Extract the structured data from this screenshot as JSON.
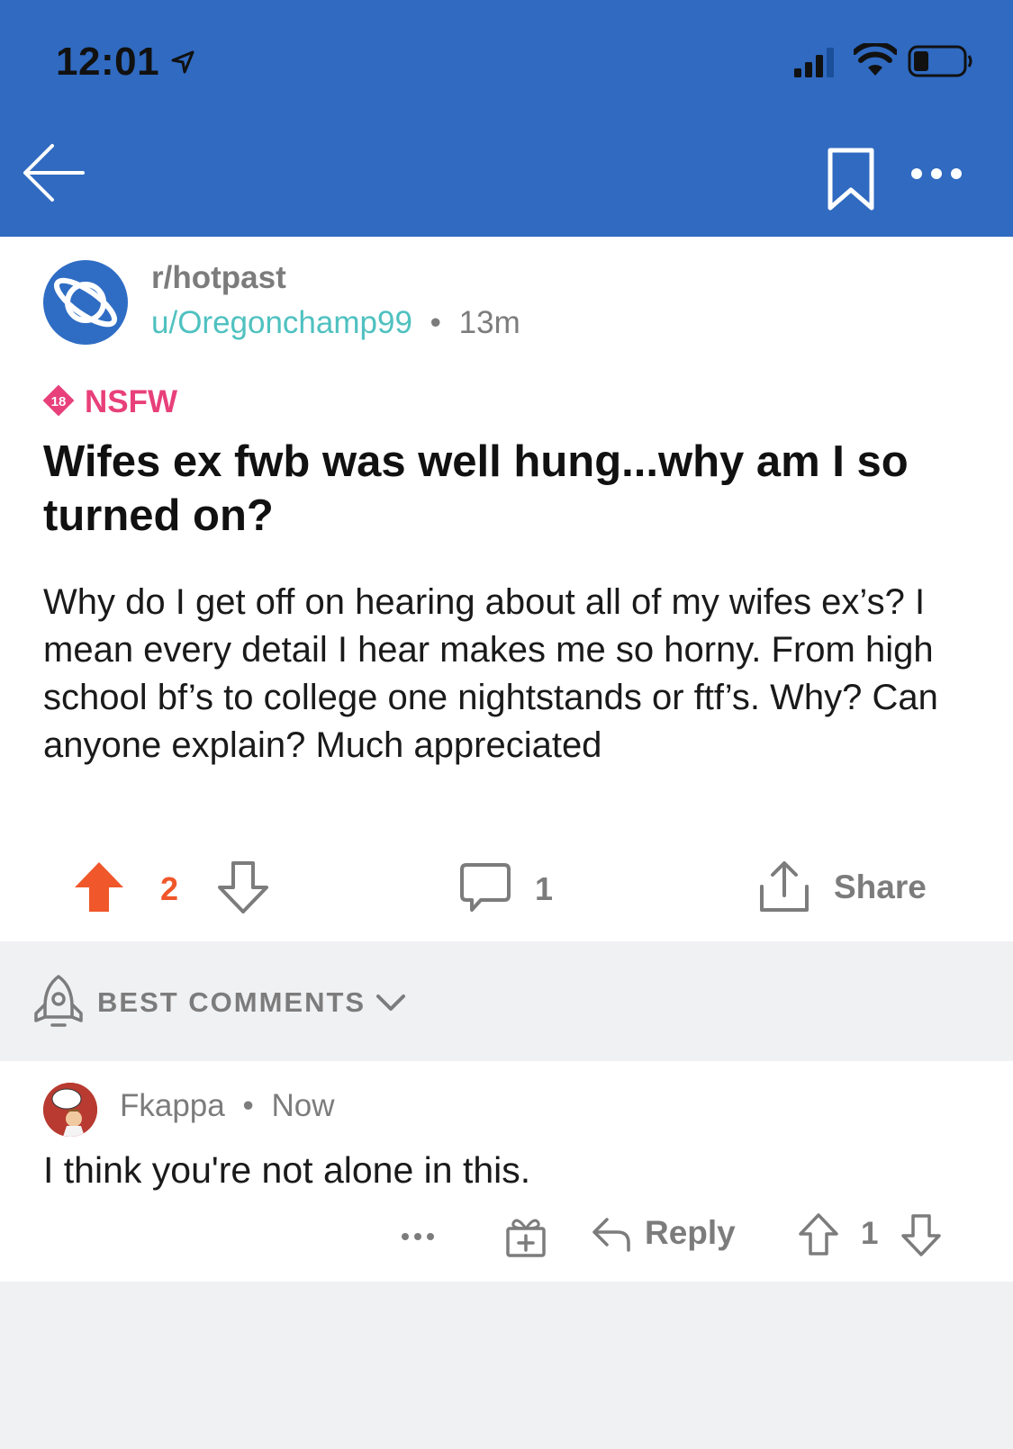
{
  "status_bar": {
    "time": "12:01"
  },
  "post": {
    "subreddit": "r/hotpast",
    "author": "u/Oregonchamp99",
    "separator": "•",
    "age": "13m",
    "nsfw_badge_number": "18",
    "nsfw_label": "NSFW",
    "title": "Wifes ex fwb was well hung...why am I so turned on?",
    "body": "Why do I get off on hearing about all of my wifes ex’s? I mean every detail I hear makes me so horny. From high school bf’s to college one nightstands or ftf’s. Why? Can anyone explain? Much appreciated",
    "vote_count": "2",
    "comment_count": "1",
    "share_label": "Share"
  },
  "sort": {
    "label": "BEST COMMENTS"
  },
  "comment": {
    "author": "Fkappa",
    "separator": "•",
    "age": "Now",
    "text": "I think you're not alone in this.",
    "reply_label": "Reply",
    "vote_count": "1"
  },
  "colors": {
    "header_blue": "#306ac1",
    "upvote_orange": "#f0572a",
    "nsfw_pink": "#e8407a",
    "username_teal": "#4fc1c0"
  }
}
